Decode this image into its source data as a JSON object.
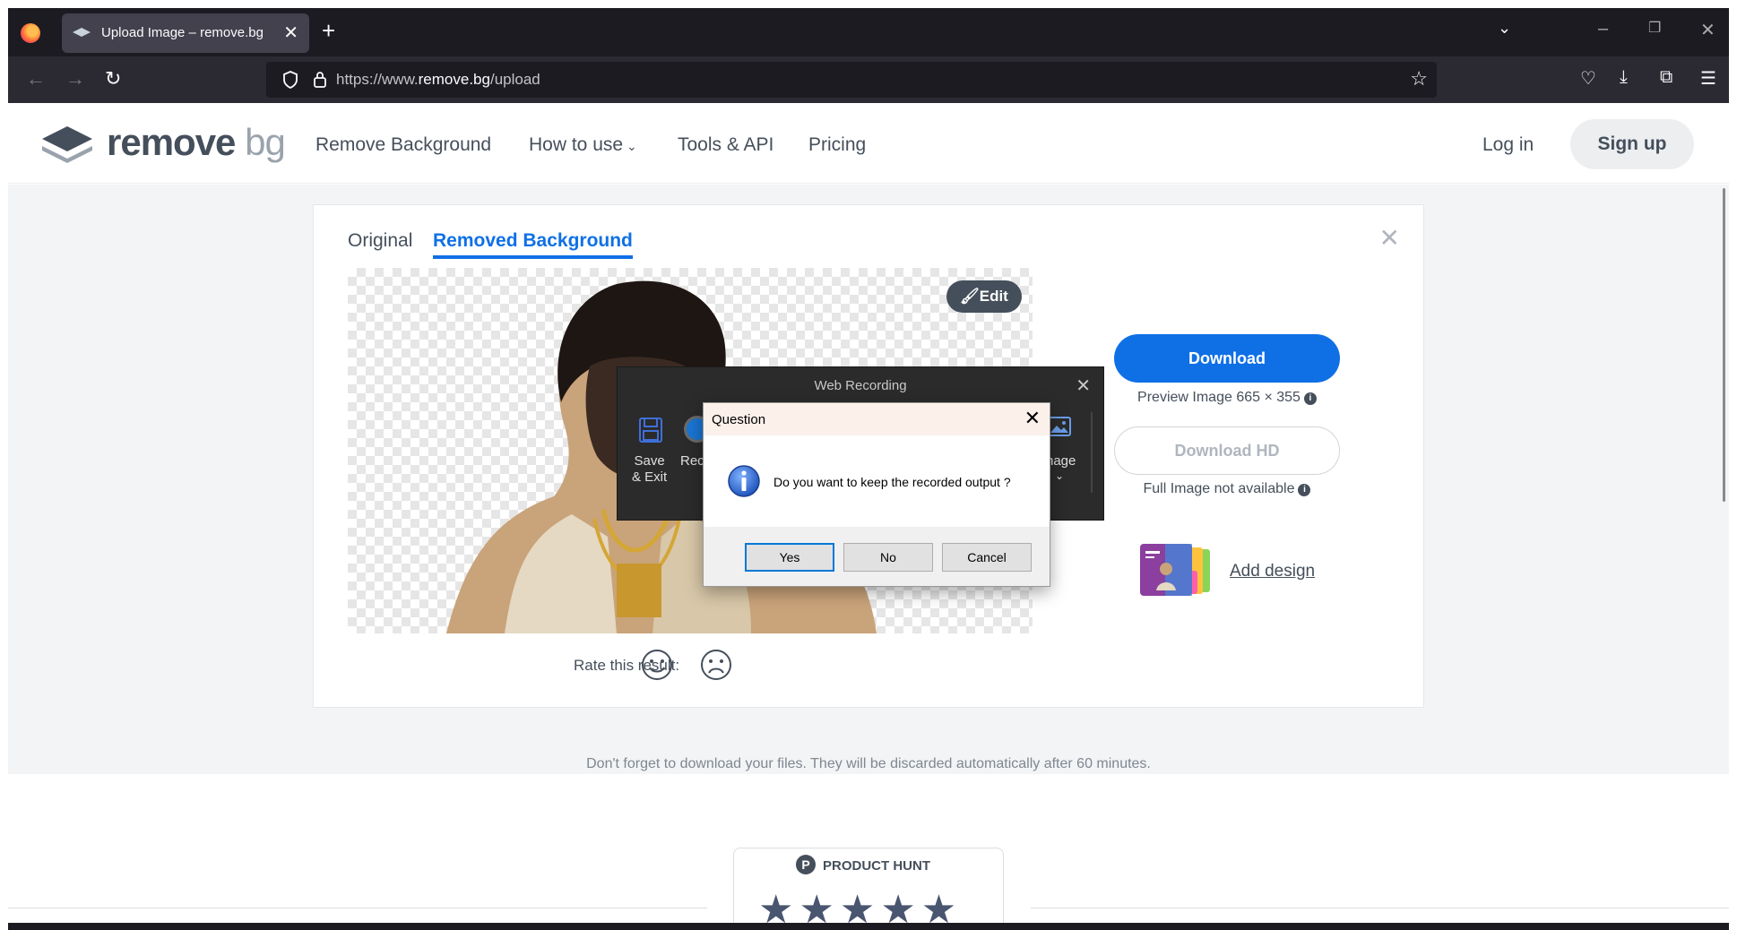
{
  "browser": {
    "tab_title": "Upload Image – remove.bg",
    "url_prefix": "https://www.",
    "url_domain": "remove.bg",
    "url_path": "/upload"
  },
  "site": {
    "logo_main": "remove",
    "logo_suffix": "bg",
    "nav": [
      {
        "label": "Remove Background"
      },
      {
        "label": "How to use"
      },
      {
        "label": "Tools & API"
      },
      {
        "label": "Pricing"
      }
    ],
    "login": "Log in",
    "signup": "Sign up"
  },
  "editor": {
    "tab_original": "Original",
    "tab_removed": "Removed Background",
    "edit_button": "Edit",
    "download_button": "Download",
    "preview_info": "Preview Image 665 × 355",
    "download_hd_button": "Download HD",
    "full_image_info": "Full Image not available",
    "add_design": "Add design",
    "rate_label": "Rate this result:"
  },
  "footnote": "Don't forget to download your files. They will be discarded automatically after 60 minutes.",
  "product_hunt": {
    "badge": "P",
    "label": "PRODUCT HUNT",
    "stars": "★★★★★"
  },
  "web_recording": {
    "title": "Web Recording",
    "save_label_1": "Save",
    "save_label_2": "& Exit",
    "rec_label": "Rec",
    "image_label": "nage"
  },
  "dialog": {
    "title": "Question",
    "message": "Do you want to keep the recorded output ?",
    "yes": "Yes",
    "no": "No",
    "cancel": "Cancel"
  },
  "colors": {
    "accent": "#0f70e6",
    "text": "#454f5b",
    "chrome_dark": "#1c1b22"
  }
}
